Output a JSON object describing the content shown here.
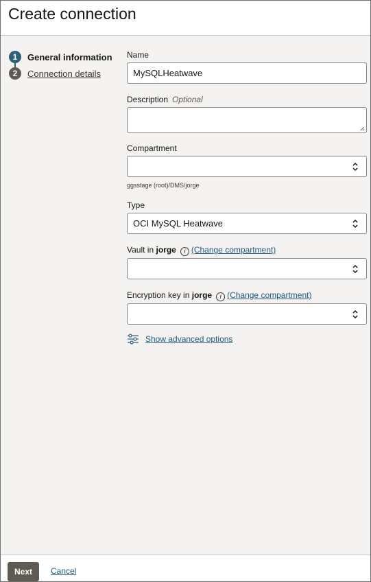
{
  "dialog": {
    "title": "Create connection"
  },
  "steps": [
    {
      "number": "1",
      "label": "General information"
    },
    {
      "number": "2",
      "label": "Connection details"
    }
  ],
  "form": {
    "name": {
      "label": "Name",
      "value": "MySQLHeatwave"
    },
    "description": {
      "label": "Description",
      "optional": "Optional",
      "value": ""
    },
    "compartment": {
      "label": "Compartment",
      "value": "",
      "helper": "ggsstage (root)/DMS/jorge"
    },
    "type": {
      "label": "Type",
      "value": "OCI MySQL Heatwave"
    },
    "vault": {
      "label_prefix": "Vault in",
      "label_strong": "jorge",
      "change_link": "(Change compartment)",
      "value": ""
    },
    "encryption_key": {
      "label_prefix": "Encryption key in",
      "label_strong": "jorge",
      "change_link": "(Change compartment)",
      "value": ""
    },
    "advanced": {
      "label": "Show advanced options"
    }
  },
  "footer": {
    "next_label": "Next",
    "cancel_label": "Cancel"
  },
  "colors": {
    "accent": "#2c5f7c",
    "link": "#1e5a80",
    "panel": "#f4f3f1",
    "next_button": "#5f5a53"
  }
}
